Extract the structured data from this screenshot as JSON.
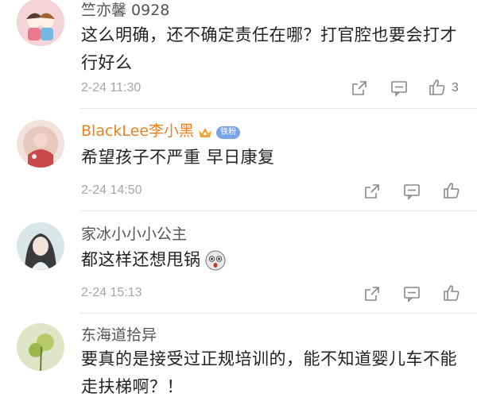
{
  "comments": [
    {
      "username": "竺亦馨 0928",
      "text": "这么明确，还不确定责任在哪？打官腔也要会打才行好么",
      "time": "2-24 11:30",
      "like_count": "3"
    },
    {
      "username": "BlackLee李小黑",
      "fan_badge": "铁粉",
      "text": "希望孩子不严重 早日康复",
      "time": "2-24 14:50"
    },
    {
      "username": "家冰小小小公主",
      "text": "都这样还想甩锅",
      "time": "2-24 15:13"
    },
    {
      "username": "东海道拾异",
      "text": "要真的是接受过正规培训的，能不知道婴儿车不能走扶梯啊？！"
    }
  ],
  "icons": {
    "share": "share-icon",
    "comment": "comment-icon",
    "like": "like-icon",
    "emoji": "surprised-face-icon",
    "crown": "crown-icon"
  },
  "colors": {
    "vip_name": "#e8821e",
    "badge_bg": "#7ba4e8",
    "time_gray": "#a6a6a6"
  }
}
